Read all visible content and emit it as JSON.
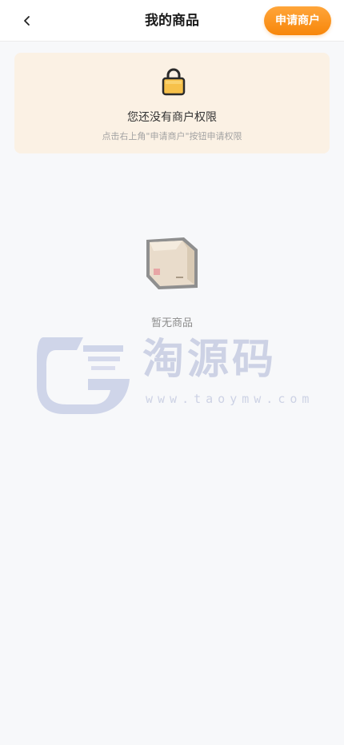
{
  "header": {
    "back_icon": "chevron-left-icon",
    "title": "我的商品",
    "apply_button_label": "申请商户",
    "apply_button_color": "#f7860a"
  },
  "notice": {
    "icon": "lock-icon",
    "title": "您还没有商户权限",
    "subtitle": "点击右上角\"申请商户\"按钮申请权限",
    "background_color": "#fbf1e4"
  },
  "empty_state": {
    "icon": "box-icon",
    "text": "暂无商品"
  },
  "watermark": {
    "text": "淘源码",
    "url": "www.taoymw.com"
  }
}
